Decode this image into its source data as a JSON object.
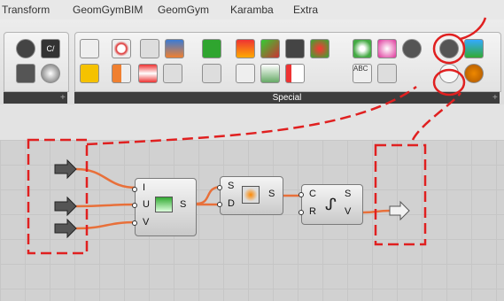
{
  "menu_tabs": [
    "Transform",
    "GeomGymBIM",
    "GeomGym",
    "Karamba",
    "Extra"
  ],
  "ribbon": {
    "group_label": "Special"
  },
  "canvas": {
    "component_1": {
      "inputs": [
        "I",
        "U",
        "V"
      ],
      "outputs": [
        "S"
      ]
    },
    "component_2": {
      "inputs": [
        "S",
        "D"
      ],
      "outputs": [
        "S"
      ]
    },
    "component_3": {
      "inputs": [
        "C",
        "R"
      ],
      "outputs": [
        "S",
        "V"
      ]
    }
  },
  "colors": {
    "wire": "#e8703a",
    "annotation": "#e02020",
    "group_bar": "#3d3d3d"
  },
  "icons": [
    "hexagon-icon",
    "circle-c-icon",
    "gear-hex-icon",
    "sphere-icon",
    "param-input-icon",
    "param-output-icon"
  ]
}
